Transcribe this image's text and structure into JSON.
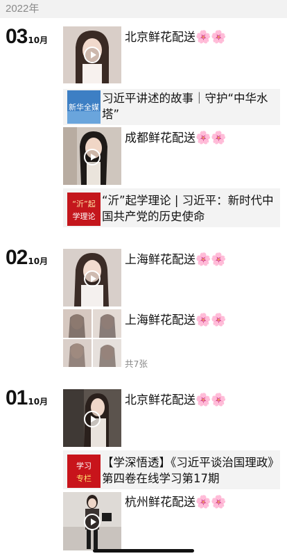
{
  "year_header": "2022年",
  "sections": [
    {
      "day": "03",
      "month": "10月"
    },
    {
      "day": "02",
      "month": "10月"
    },
    {
      "day": "01",
      "month": "10月"
    }
  ],
  "posts": {
    "p1": "北京鲜花配送",
    "p2": "成都鲜花配送",
    "p3": "上海鲜花配送",
    "p4": "上海鲜花配送",
    "p5": "北京鲜花配送",
    "p6": "杭州鲜花配送"
  },
  "flowers": "🌸🌸",
  "articles": {
    "a1": {
      "title": "习近平讲述的故事｜守护“中华水塔”",
      "img_text": "新华全媒"
    },
    "a2": {
      "title": "“沂”起学理论 | 习近平：新时代中国共产党的历史使命",
      "img_text_1": "“沂”起",
      "img_text_2": "学理论"
    },
    "a3": {
      "title": "【学深悟透】《习近平谈治国理政》第四卷在线学习第17期",
      "img_text_1": "学习",
      "img_text_2": "专栏"
    }
  },
  "album_count": "共7张"
}
